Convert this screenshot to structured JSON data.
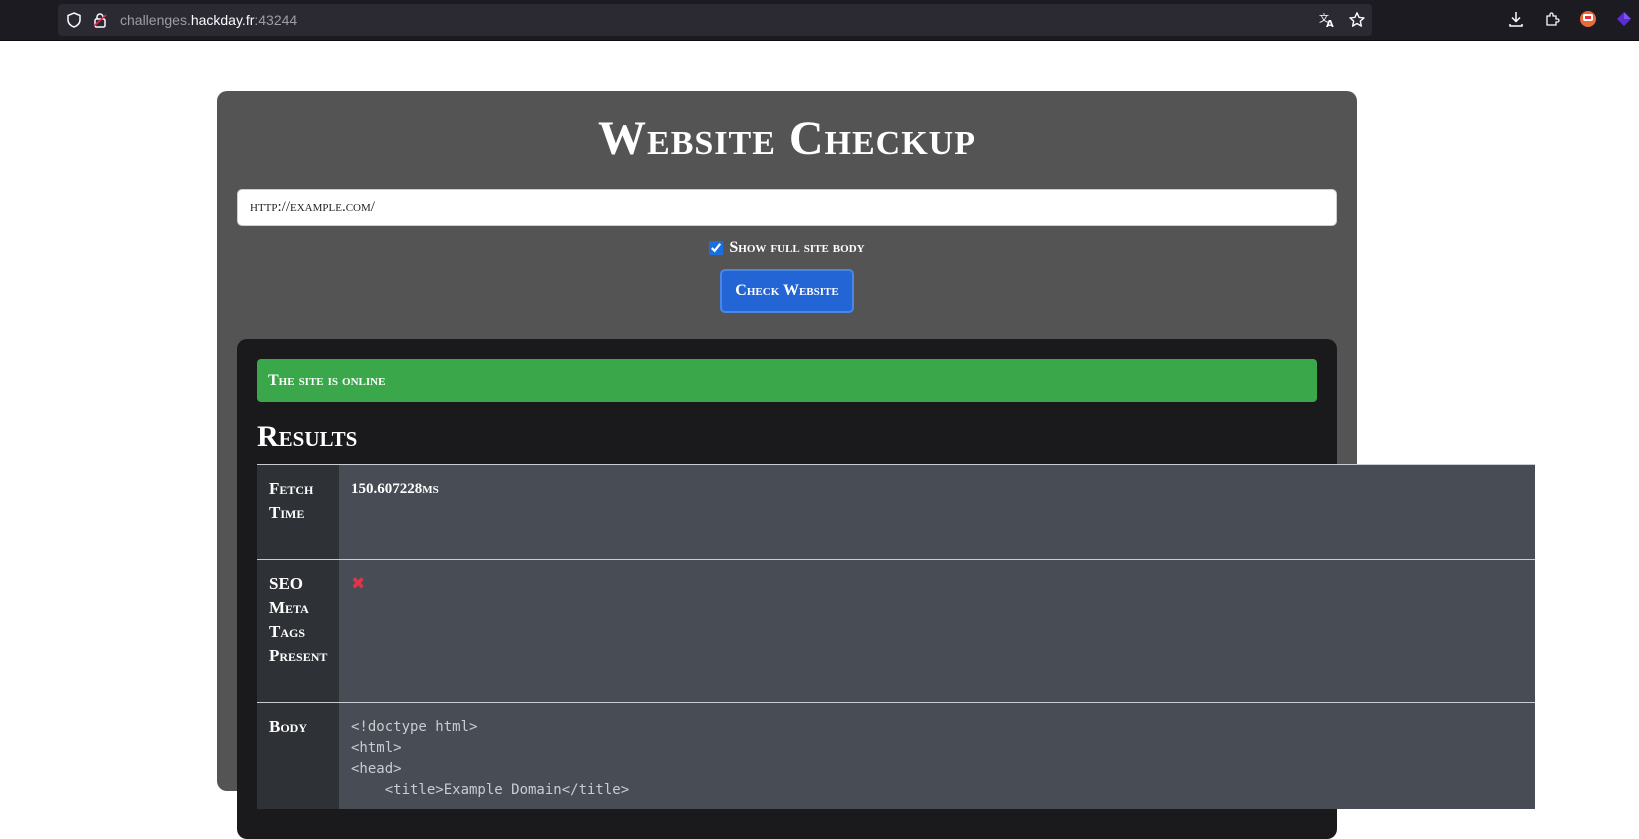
{
  "browser": {
    "url_prefix": "challenges.",
    "url_host": "hackday.fr",
    "url_suffix": ":43244"
  },
  "page": {
    "title": "Website Checkup",
    "url_value": "http://example.com/",
    "show_body_label": "Show full site body",
    "show_body_checked": true,
    "check_button": "Check Website"
  },
  "results": {
    "status_message": "The site is online",
    "heading": "Results",
    "rows": [
      {
        "label": "Fetch Time",
        "value": "150.607228ms"
      },
      {
        "label": "SEO Meta Tags Present",
        "value": "✖"
      },
      {
        "label": "Body",
        "value": "<!doctype html>\n<html>\n<head>\n    <title>Example Domain</title>"
      }
    ]
  },
  "colors": {
    "card_bg": "#545454",
    "panel_bg": "#1a1a1c",
    "success": "#3aa84a",
    "primary_button": "#2465d6",
    "error_cross": "#e0344a"
  },
  "icons": {
    "shield": "shield-icon",
    "lock": "lock-icon",
    "translate": "translate-icon",
    "bookmark": "star-icon",
    "download": "download-icon",
    "extensions": "puzzle-icon",
    "profile": "profile-icon",
    "extension_badge": "cube-icon"
  }
}
